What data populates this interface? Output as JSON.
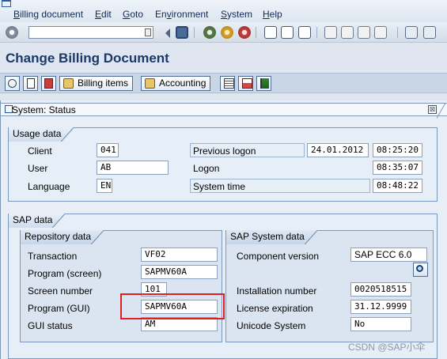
{
  "menu": {
    "items": [
      {
        "label": "Billing document",
        "key": "B",
        "rest": "illing document"
      },
      {
        "label": "Edit",
        "key": "E",
        "rest": "dit"
      },
      {
        "label": "Goto",
        "key": "G",
        "rest": "oto"
      },
      {
        "label": "Environment",
        "key": "",
        "prefix": "En",
        "key2": "v",
        "rest": "ironment"
      },
      {
        "label": "System",
        "key": "S",
        "rest": "ystem"
      },
      {
        "label": "Help",
        "key": "H",
        "rest": "elp"
      }
    ]
  },
  "toolbar": {
    "command_value": "",
    "icons": [
      "enter-icon",
      "save-icon",
      "back-icon",
      "exit-icon",
      "cancel-icon",
      "print-icon",
      "find-icon",
      "find-next-icon",
      "first-page-icon",
      "previous-page-icon",
      "next-page-icon",
      "last-page-icon",
      "new-session-icon",
      "shortcut-icon"
    ]
  },
  "title": "Change Billing Document",
  "app_toolbar": {
    "billing_items_label": "Billing items",
    "accounting_label": "Accounting"
  },
  "dialog": {
    "title": "System: Status",
    "close_glyph": "⊠"
  },
  "usage_data": {
    "group_label": "Usage data",
    "client_label": "Client",
    "client_value": "041",
    "user_label": "User",
    "user_value": "AB",
    "language_label": "Language",
    "language_value": "EN",
    "previous_logon_label": "Previous logon",
    "previous_logon_date": "24.01.2012",
    "previous_logon_time": "08:25:20",
    "logon_label": "Logon",
    "logon_time": "08:35:07",
    "system_time_label": "System time",
    "system_time_value": "08:48:22"
  },
  "sap_data": {
    "group_label": "SAP data",
    "repository": {
      "group_label": "Repository data",
      "transaction_label": "Transaction",
      "transaction_value": "VF02",
      "program_screen_label": "Program (screen)",
      "program_screen_value": "SAPMV60A",
      "screen_number_label": "Screen number",
      "screen_number_value": "101",
      "program_gui_label": "Program (GUI)",
      "program_gui_value": "SAPMV60A",
      "gui_status_label": "GUI status",
      "gui_status_value": "AM"
    },
    "system": {
      "group_label": "SAP System data",
      "component_version_label": "Component version",
      "component_version_value": "SAP ECC 6.0",
      "installation_number_label": "Installation number",
      "installation_number_value": "0020518515",
      "license_expiration_label": "License expiration",
      "license_expiration_value": "31.12.9999",
      "unicode_label": "Unicode System",
      "unicode_value": "No"
    }
  },
  "watermark": "CSDN @SAP小伞",
  "colors": {
    "title": "#1b3968",
    "highlight": "#e02020",
    "field_border": "#8aa0bb",
    "group_border": "#7b97bb"
  }
}
